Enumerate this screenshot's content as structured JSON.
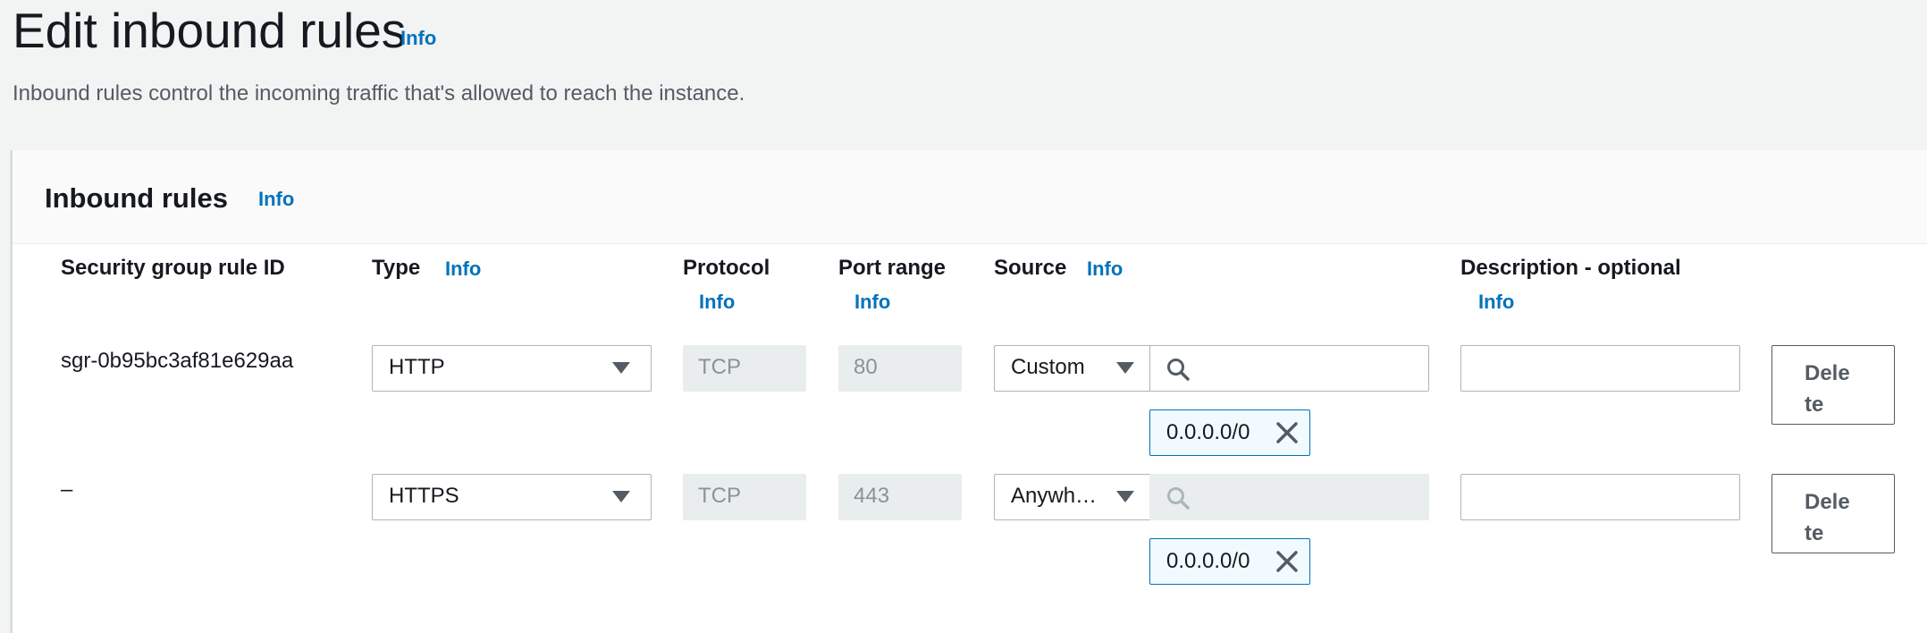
{
  "page": {
    "title": "Edit inbound rules",
    "title_info": "Info",
    "description": "Inbound rules control the incoming traffic that's allowed to reach the instance."
  },
  "panel": {
    "title": "Inbound rules",
    "info": "Info"
  },
  "columns": {
    "rule_id": "Security group rule ID",
    "type": "Type",
    "type_info": "Info",
    "protocol": "Protocol",
    "protocol_info": "Info",
    "port_range": "Port range",
    "port_range_info": "Info",
    "source": "Source",
    "source_info": "Info",
    "description": "Description - optional",
    "description_info": "Info"
  },
  "rules": [
    {
      "rule_id": "sgr-0b95bc3af81e629aa",
      "type": "HTTP",
      "protocol": "TCP",
      "port_range": "80",
      "source_type": "Custom",
      "source_search": "",
      "source_token": "0.0.0.0/0",
      "description": "",
      "delete_label": "Delete"
    },
    {
      "rule_id": "–",
      "type": "HTTPS",
      "protocol": "TCP",
      "port_range": "443",
      "source_type": "Anywh…",
      "source_search": "",
      "source_token": "0.0.0.0/0",
      "description": "",
      "delete_label": "Delete"
    }
  ],
  "icons": {
    "dropdown": "caret-down-icon",
    "search": "search-icon",
    "remove_token": "close-icon"
  },
  "colors": {
    "link": "#0073bb",
    "background": "#f2f3f3",
    "token_bg": "#f1faff",
    "readonly_bg": "#eaeded"
  }
}
